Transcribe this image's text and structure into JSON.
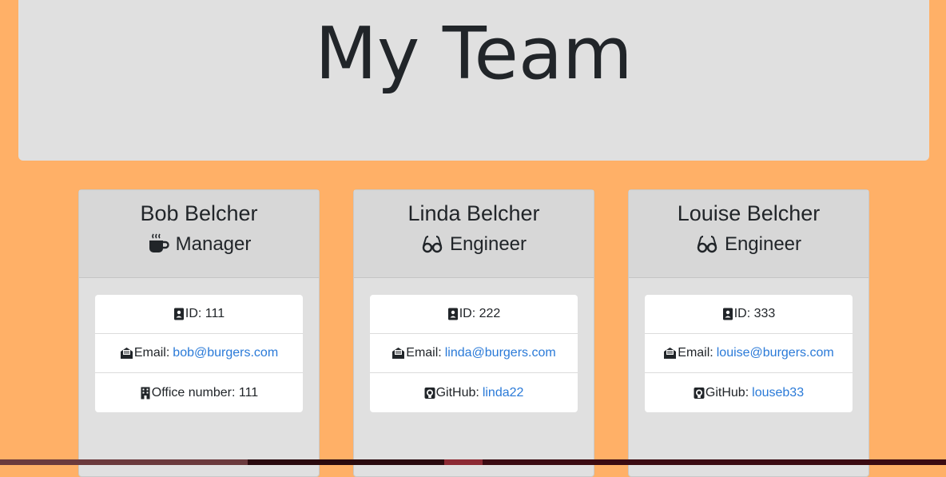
{
  "header": {
    "title": "My Team"
  },
  "colors": {
    "background": "#FFB067",
    "jumbotron": "#E0E0E0",
    "card_header": "#D7D7D7",
    "link": "#2a7ad8"
  },
  "cards": [
    {
      "name": "Bob Belcher",
      "role": "Manager",
      "role_icon": "coffee-mug-icon",
      "id_label": "ID: 111",
      "email_label": "Email:",
      "email": "bob@burgers.com",
      "extra_icon": "building-icon",
      "extra_label": "Office number: 111",
      "extra_link": ""
    },
    {
      "name": "Linda Belcher",
      "role": "Engineer",
      "role_icon": "glasses-icon",
      "id_label": "ID: 222",
      "email_label": "Email:",
      "email": "linda@burgers.com",
      "extra_icon": "github-icon",
      "extra_label": "GitHub:",
      "extra_link": "linda22"
    },
    {
      "name": "Louise Belcher",
      "role": "Engineer",
      "role_icon": "glasses-icon",
      "id_label": "ID: 333",
      "email_label": "Email:",
      "email": "louise@burgers.com",
      "extra_icon": "github-icon",
      "extra_label": "GitHub:",
      "extra_link": "louseb33"
    }
  ]
}
